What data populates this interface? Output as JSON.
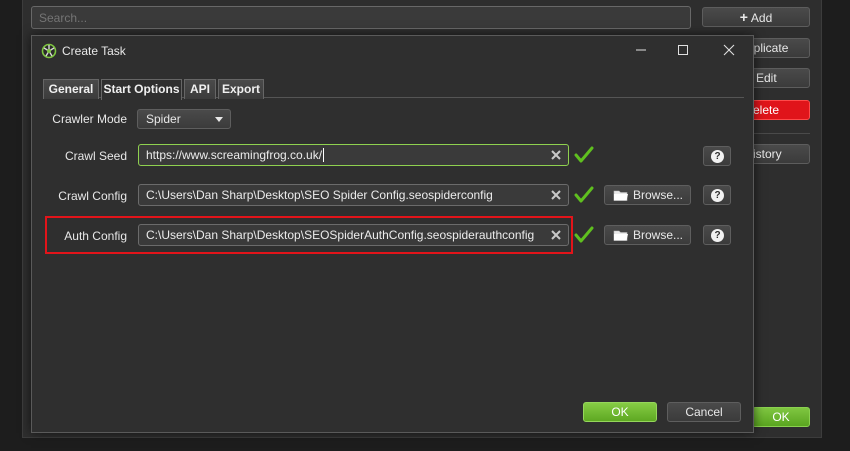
{
  "background": {
    "search_placeholder": "Search...",
    "add_label": "Add",
    "duplicate_label_visible": "uplicate",
    "edit_label_visible": "Edit",
    "delete_label_visible": "elete",
    "history_label_visible": "istory",
    "ok_label": "OK"
  },
  "dialog": {
    "title": "Create Task",
    "tabs": [
      {
        "label": "General",
        "active": false
      },
      {
        "label": "Start Options",
        "active": true
      },
      {
        "label": "API",
        "active": false
      },
      {
        "label": "Export",
        "active": false
      }
    ],
    "crawler_mode": {
      "label": "Crawler Mode",
      "value": "Spider"
    },
    "crawl_seed": {
      "label": "Crawl Seed",
      "value": "https://www.screamingfrog.co.uk/"
    },
    "crawl_config": {
      "label": "Crawl Config",
      "value": "C:\\Users\\Dan Sharp\\Desktop\\SEO Spider Config.seospiderconfig"
    },
    "auth_config": {
      "label": "Auth Config",
      "value": "C:\\Users\\Dan Sharp\\Desktop\\SEOSpiderAuthConfig.seospiderauthconfig"
    },
    "browse_label": "Browse...",
    "ok_label": "OK",
    "cancel_label": "Cancel"
  },
  "colors": {
    "accent_green": "#6fbf2e",
    "highlight_red": "#e3141a",
    "delete_red": "#e0141a",
    "background": "#2f2f2f"
  },
  "icons": [
    "frog-app-icon",
    "minimize-icon",
    "maximize-icon",
    "close-icon",
    "clear-icon",
    "check-icon",
    "folder-icon",
    "help-icon",
    "plus-icon",
    "chevron-down-icon"
  ]
}
